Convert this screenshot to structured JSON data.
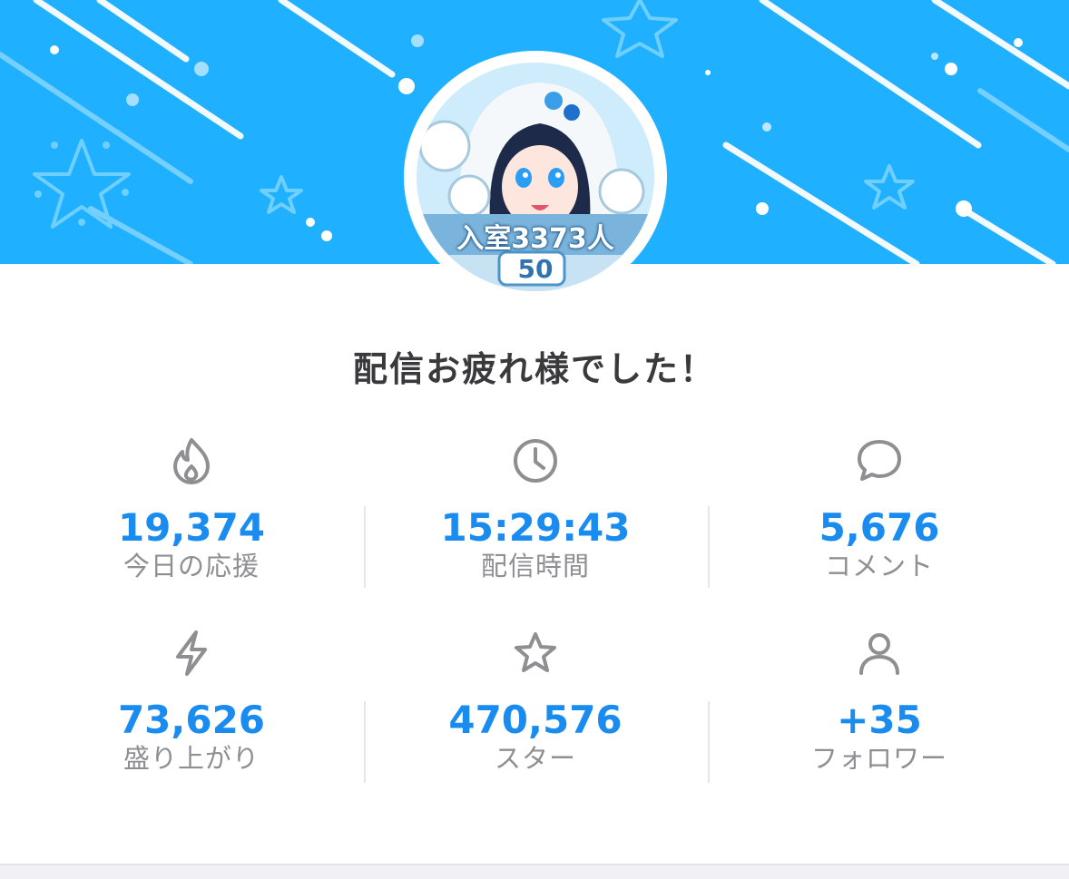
{
  "header": {
    "banner_color": "#1fb0ff"
  },
  "avatar": {
    "badge_line1": "入室3373人",
    "badge_line2": "50"
  },
  "title": "配信お疲れ様でした！",
  "accent_color": "#1a8cf0",
  "stats": [
    {
      "icon": "flame-icon",
      "value": "19,374",
      "label": "今日の応援"
    },
    {
      "icon": "clock-icon",
      "value": "15:29:43",
      "label": "配信時間"
    },
    {
      "icon": "comment-icon",
      "value": "5,676",
      "label": "コメント"
    },
    {
      "icon": "lightning-icon",
      "value": "73,626",
      "label": "盛り上がり"
    },
    {
      "icon": "star-icon",
      "value": "470,576",
      "label": "スター"
    },
    {
      "icon": "person-icon",
      "value": "+35",
      "label": "フォロワー"
    }
  ]
}
